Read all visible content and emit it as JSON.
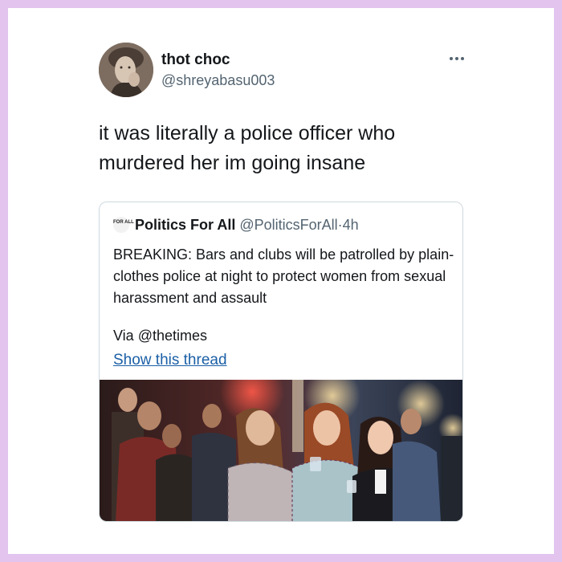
{
  "tweet": {
    "display_name": "thot choc",
    "handle": "@shreyabasu003",
    "text": "it was literally a police officer who murdered her im going insane"
  },
  "quoted_tweet": {
    "logo_text": "FOR ALL",
    "display_name": "Politics For All",
    "handle": "@PoliticsForAll",
    "separator": "·",
    "time": "4h",
    "text": "BREAKING: Bars and clubs will be patrolled by plain-clothes police at night to protect women from sexual harassment and assault",
    "via": "Via @thetimes",
    "show_thread": "Show this thread"
  },
  "icons": {
    "more": "more-horizontal-icon"
  },
  "colors": {
    "frame": "#e2c4ef",
    "link": "#1b5fa6",
    "secondary_text": "#536471"
  }
}
